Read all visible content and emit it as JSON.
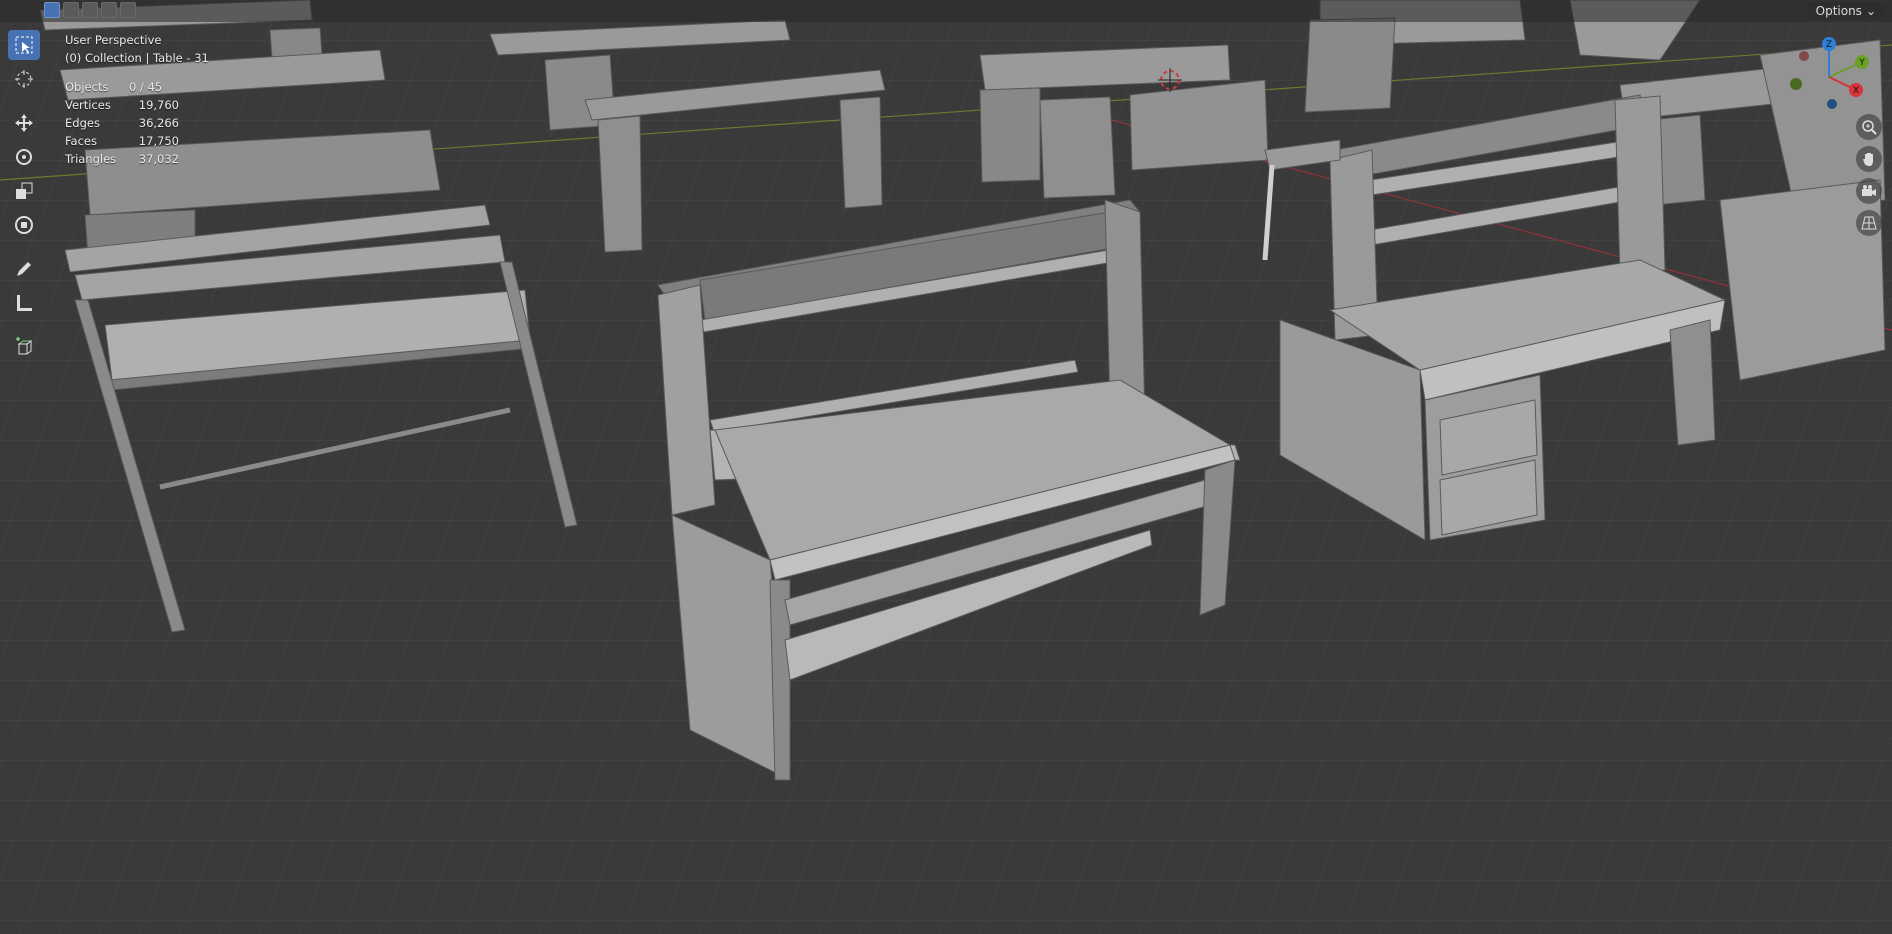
{
  "viewport": {
    "view_name": "User Perspective",
    "collection_label": "(0) Collection | Table - 31"
  },
  "stats": [
    {
      "label": "Objects",
      "value": "0 / 45"
    },
    {
      "label": "Vertices",
      "value": "19,760"
    },
    {
      "label": "Edges",
      "value": "36,266"
    },
    {
      "label": "Faces",
      "value": "17,750"
    },
    {
      "label": "Triangles",
      "value": "37,032"
    }
  ],
  "header": {
    "options_label": "Options",
    "mode_buttons": [
      "select-box-new",
      "select-box-extend",
      "select-box-subtract",
      "select-box-invert",
      "select-box-intersect"
    ]
  },
  "toolbar": {
    "tools": [
      "select-box-icon",
      "cursor-icon",
      "move-icon",
      "rotate-icon",
      "scale-icon",
      "transform-icon",
      "annotate-icon",
      "measure-icon",
      "add-cube-icon"
    ],
    "active_tool": "select-box-icon"
  },
  "gizmo": {
    "axes": [
      {
        "name": "Z",
        "color": "#2f7fd6"
      },
      {
        "name": "Y",
        "color": "#6aa124"
      },
      {
        "name": "X",
        "color": "#d8323c"
      }
    ]
  },
  "nav_buttons": [
    "zoom-icon",
    "pan-hand-icon",
    "camera-icon",
    "grid-perspective-icon"
  ],
  "colors": {
    "background": "#3c3c3c",
    "grid": "#4a4a4a",
    "object_light": "#a9a9a9",
    "object_mid": "#8e8e8e",
    "object_dark": "#6e6e6e",
    "active_tool": "#4772b3"
  }
}
